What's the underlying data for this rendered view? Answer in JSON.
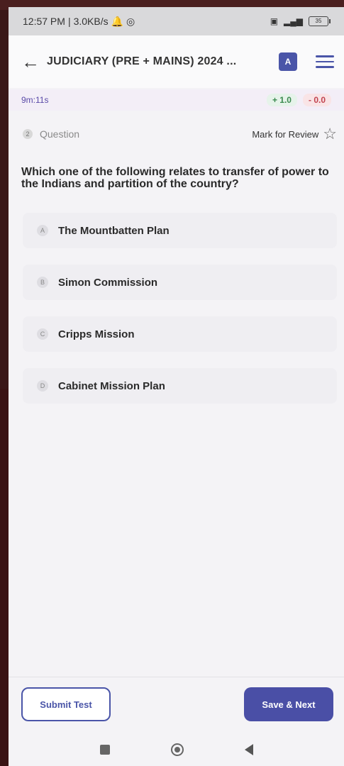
{
  "status": {
    "time": "12:57 PM",
    "net": "3.0KB/s",
    "battery": "35"
  },
  "appbar": {
    "title": "JUDICIARY (PRE + MAINS) 2024 ..."
  },
  "timer": {
    "value": "9m:11s",
    "plus": "+ 1.0",
    "minus": "- 0.0"
  },
  "question": {
    "number": "2",
    "label": "Question",
    "review_label": "Mark for Review",
    "text": "Which one of the following relates to transfer of power to the Indians and partition of the country?"
  },
  "options": [
    {
      "letter": "A",
      "text": "The Mountbatten Plan"
    },
    {
      "letter": "B",
      "text": "Simon Commission"
    },
    {
      "letter": "C",
      "text": "Cripps Mission"
    },
    {
      "letter": "D",
      "text": "Cabinet Mission Plan"
    }
  ],
  "buttons": {
    "submit": "Submit Test",
    "save": "Save & Next"
  },
  "colors": {
    "accent": "#4a55a8",
    "plus": "#3b8a4f",
    "minus": "#c2434f"
  }
}
